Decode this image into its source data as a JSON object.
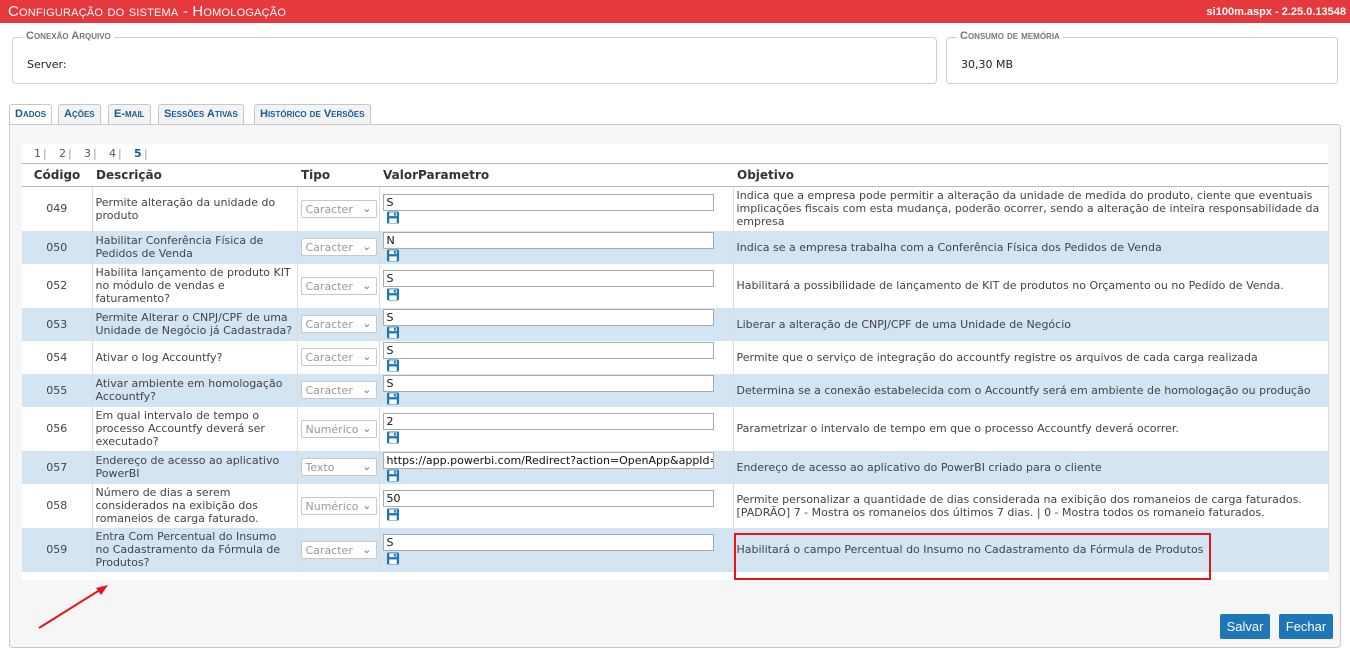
{
  "titlebar": {
    "title": "Configuração do sistema  - Homologação",
    "version": "si100m.aspx - 2.25.0.13548"
  },
  "connection": {
    "legend": "Conexão Arquivo",
    "server_label": "Server:"
  },
  "memory": {
    "legend": "Consumo de memória",
    "value": "30,30 MB"
  },
  "tabs": [
    {
      "label": "Dados",
      "active": true
    },
    {
      "label": "Ações",
      "active": false
    },
    {
      "label": "E-mail",
      "active": false
    },
    {
      "label": "Sessões Ativas",
      "active": false
    },
    {
      "label": "Histórico de Versões",
      "active": false
    }
  ],
  "pager": {
    "pages": [
      "1",
      "2",
      "3",
      "4",
      "5"
    ],
    "current": "5"
  },
  "table": {
    "headers": {
      "code": "Código",
      "description": "Descrição",
      "type": "Tipo",
      "value": "ValorParametro",
      "objective": "Objetivo"
    },
    "rows": [
      {
        "code": "049",
        "description": "Permite alteração da unidade do produto",
        "type": "Caracter",
        "value": "S",
        "objective": "Indica que a empresa pode permitir a alteração da unidade de medida do produto, ciente que eventuais implicações fiscais com esta mudança, poderão ocorrer, sendo a alteração de inteira responsabilidade da empresa"
      },
      {
        "code": "050",
        "description": "Habilitar Conferência Física de Pedidos de Venda",
        "type": "Caracter",
        "value": "N",
        "objective": "Indica se a empresa trabalha com a Conferência Física dos Pedidos de Venda"
      },
      {
        "code": "052",
        "description": "Habilita lançamento de produto KIT no módulo de vendas e faturamento?",
        "type": "Caracter",
        "value": "S",
        "objective": "Habilitará a possibilidade de lançamento de KIT de produtos no Orçamento ou no Pedido de Venda."
      },
      {
        "code": "053",
        "description": "Permite Alterar o CNPJ/CPF de uma Unidade de Negócio já Cadastrada?",
        "type": "Caracter",
        "value": "S",
        "objective": "Liberar a alteração de CNPJ/CPF de uma Unidade de Negócio"
      },
      {
        "code": "054",
        "description": "Ativar o log Accountfy?",
        "type": "Caracter",
        "value": "S",
        "objective": "Permite que o serviço de integração do accountfy registre os arquivos de cada carga realizada"
      },
      {
        "code": "055",
        "description": "Ativar ambiente em homologação Accountfy?",
        "type": "Caracter",
        "value": "S",
        "objective": "Determina se a conexão estabelecida com o Accountfy será em ambiente de homologação ou produção"
      },
      {
        "code": "056",
        "description": "Em qual intervalo de tempo o processo Accountfy deverá ser executado?",
        "type": "Numérico",
        "value": "2",
        "objective": "Parametrizar o intervalo de tempo em que o processo Accountfy deverá ocorrer."
      },
      {
        "code": "057",
        "description": "Endereço de acesso ao aplicativo PowerBI",
        "type": "Texto",
        "value": "https://app.powerbi.com/Redirect?action=OpenApp&appId=i",
        "objective": "Endereço de acesso ao aplicativo do PowerBI criado para o cliente"
      },
      {
        "code": "058",
        "description": "Número de dias a serem considerados na exibição dos romaneios de carga faturado.",
        "type": "Numérico",
        "value": "50",
        "objective": "Permite personalizar a quantidade de dias considerada na exibição dos romaneios de carga faturados. [PADRÃO] 7 - Mostra os romaneios dos últimos 7 dias. | 0 - Mostra todos os romaneio faturados."
      },
      {
        "code": "059",
        "description": "Entra Com Percentual do Insumo no Cadastramento da Fórmula de Produtos?",
        "type": "Caracter",
        "value": "S",
        "objective": "Habilitará o campo Percentual do Insumo no Cadastramento da Fórmula de Produtos"
      }
    ]
  },
  "buttons": {
    "save": "Salvar",
    "close": "Fechar"
  },
  "colors": {
    "titlebar": "#e6393d",
    "accent": "#1f76b7",
    "row_alt": "#d3e4f2",
    "highlight": "#e8141c"
  }
}
